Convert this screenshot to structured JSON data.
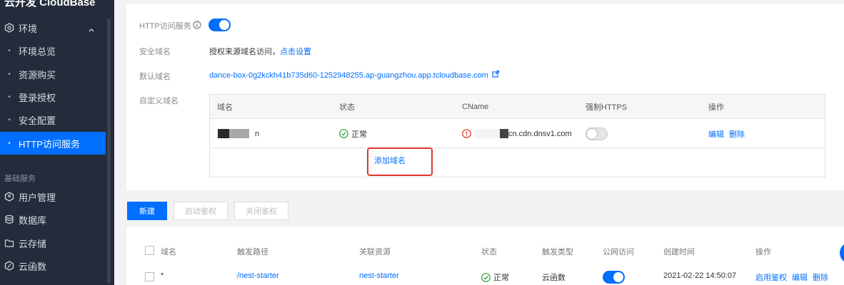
{
  "sidebar": {
    "brand": "云开发 CloudBase",
    "env_label": "环境",
    "items": [
      "环境总览",
      "资源购买",
      "登录授权",
      "安全配置",
      "HTTP访问服务"
    ],
    "group_label": "基础服务",
    "services": [
      "用户管理",
      "数据库",
      "云存储",
      "云函数"
    ]
  },
  "http_service": {
    "label": "HTTP访问服务",
    "enabled": true,
    "secure_domain_label": "安全域名",
    "secure_domain_text": "授权来源域名访问，",
    "secure_domain_link": "点击设置",
    "default_domain_label": "默认域名",
    "default_domain": "dance-box-0g2kckh41b735d60-1252948255.ap-guangzhou.app.tcloudbase.com",
    "custom_domain_label": "自定义域名"
  },
  "domain_table": {
    "headers": [
      "域名",
      "状态",
      "CName",
      "强制HTTPS",
      "操作"
    ],
    "row": {
      "domain_suffix": "n",
      "status": "正常",
      "cname": "cn.cdn.dnsv1.com",
      "force_https": false,
      "edit": "编辑",
      "delete": "删除"
    },
    "add_label": "添加域名"
  },
  "actions": {
    "new": "新建",
    "enable_auth": "启动鉴权",
    "disable_auth": "关闭鉴权"
  },
  "route_table": {
    "headers": [
      "域名",
      "触发路径",
      "关联资源",
      "状态",
      "触发类型",
      "公网访问",
      "创建时间",
      "操作"
    ],
    "row": {
      "domain": "*",
      "path": "/nest-starter",
      "resource": "nest-starter",
      "status": "正常",
      "trigger_type": "云函数",
      "public_access": true,
      "created": "2021-02-22 14:50:07",
      "op_auth": "启用鉴权",
      "op_edit": "编辑",
      "op_delete": "删除"
    }
  },
  "colors": {
    "accent": "#006eff",
    "sidebar_bg": "#232c3b",
    "success": "#2ba245",
    "error": "#e0352b"
  }
}
